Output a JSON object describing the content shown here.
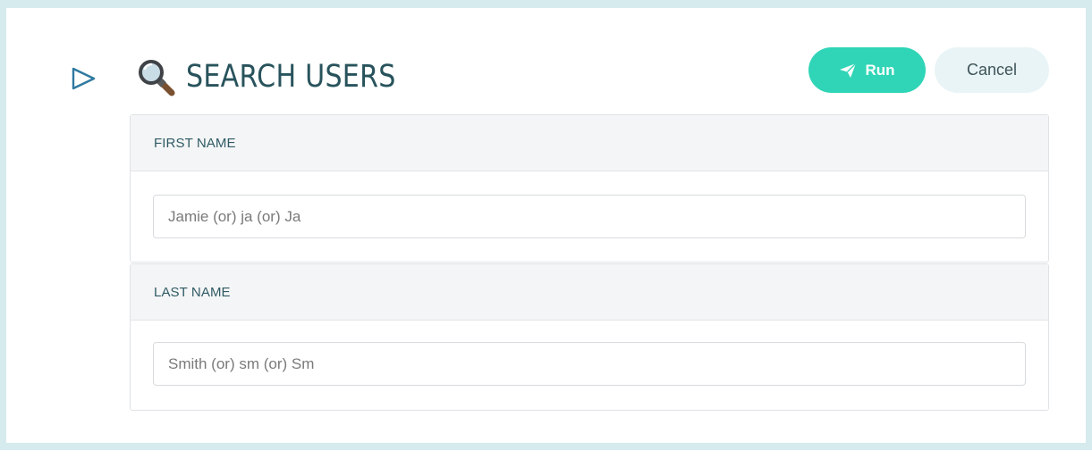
{
  "header": {
    "title": "SEARCH USERS",
    "run_label": "Run",
    "cancel_label": "Cancel"
  },
  "fields": [
    {
      "label": "FIRST NAME",
      "placeholder": "Jamie (or) ja (or) Ja",
      "value": ""
    },
    {
      "label": "LAST NAME",
      "placeholder": "Smith (or) sm (or) Sm",
      "value": ""
    }
  ],
  "icons": {
    "toggle": "play-outline-icon",
    "title": "magnifying-glass-icon",
    "run": "paper-plane-icon"
  },
  "colors": {
    "accent": "#2fd5b6",
    "title_text": "#28535c",
    "cancel_bg": "#e9f4f6",
    "page_bg": "#d6ebee"
  }
}
